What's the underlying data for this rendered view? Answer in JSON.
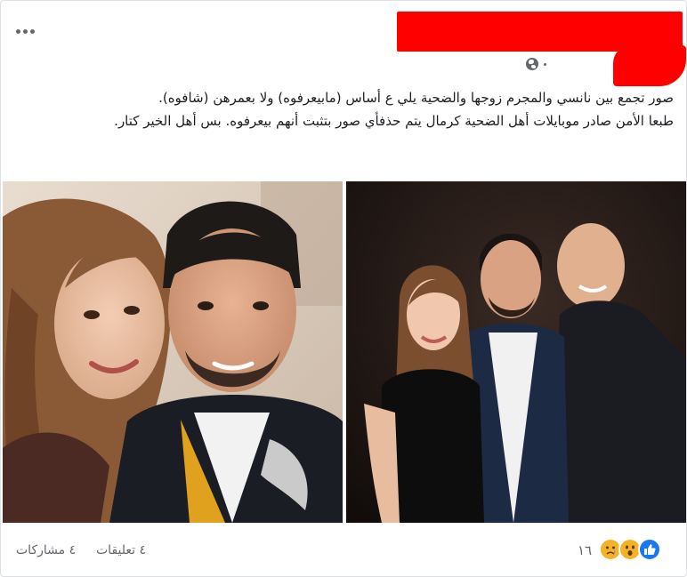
{
  "post": {
    "menu_icon": "more-horizontal-icon",
    "privacy_icon": "globe-icon",
    "text_lines": [
      "صور تجمع بين نانسي والمجرم زوجها والضحية يلي ع أساس (مابيعرفوه) ولا بعمرهن (شافوه).",
      "طبعا الأمن صادر موبايلات أهل الضحية كرمال يتم حذفأي صور بتثبت أنهم بيعرفوه. بس أهل الخير كتار."
    ]
  },
  "footer": {
    "shares": "٤ مشاركات",
    "comments": "٤ تعليقات",
    "reactions_count": "١٦",
    "reaction_icons": [
      "sad-face-icon",
      "wow-face-icon",
      "like-icon"
    ]
  },
  "colors": {
    "redaction": "#ff0000",
    "like_blue": "#1877f2",
    "emoji_yellow": "#f7b125",
    "meta_gray": "#65676b"
  }
}
